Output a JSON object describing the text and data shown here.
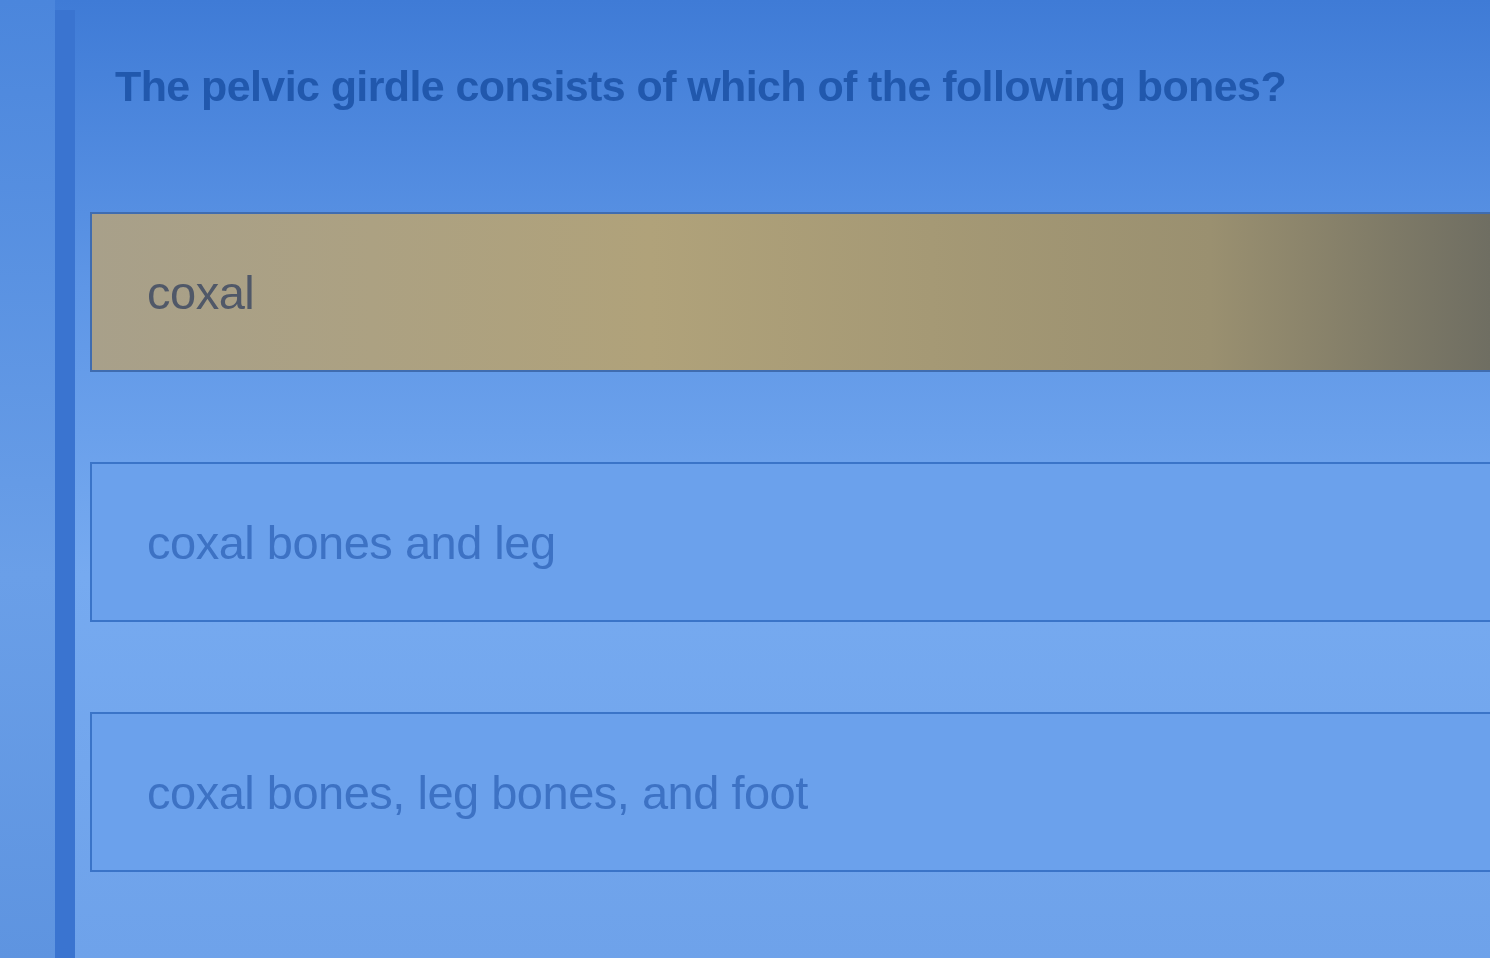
{
  "question": {
    "text": "The pelvic girdle consists of which of the following bones?"
  },
  "options": [
    {
      "label": "coxal",
      "selected": true
    },
    {
      "label": "coxal bones and leg",
      "selected": false
    },
    {
      "label": "coxal bones, leg bones, and foot",
      "selected": false
    }
  ]
}
